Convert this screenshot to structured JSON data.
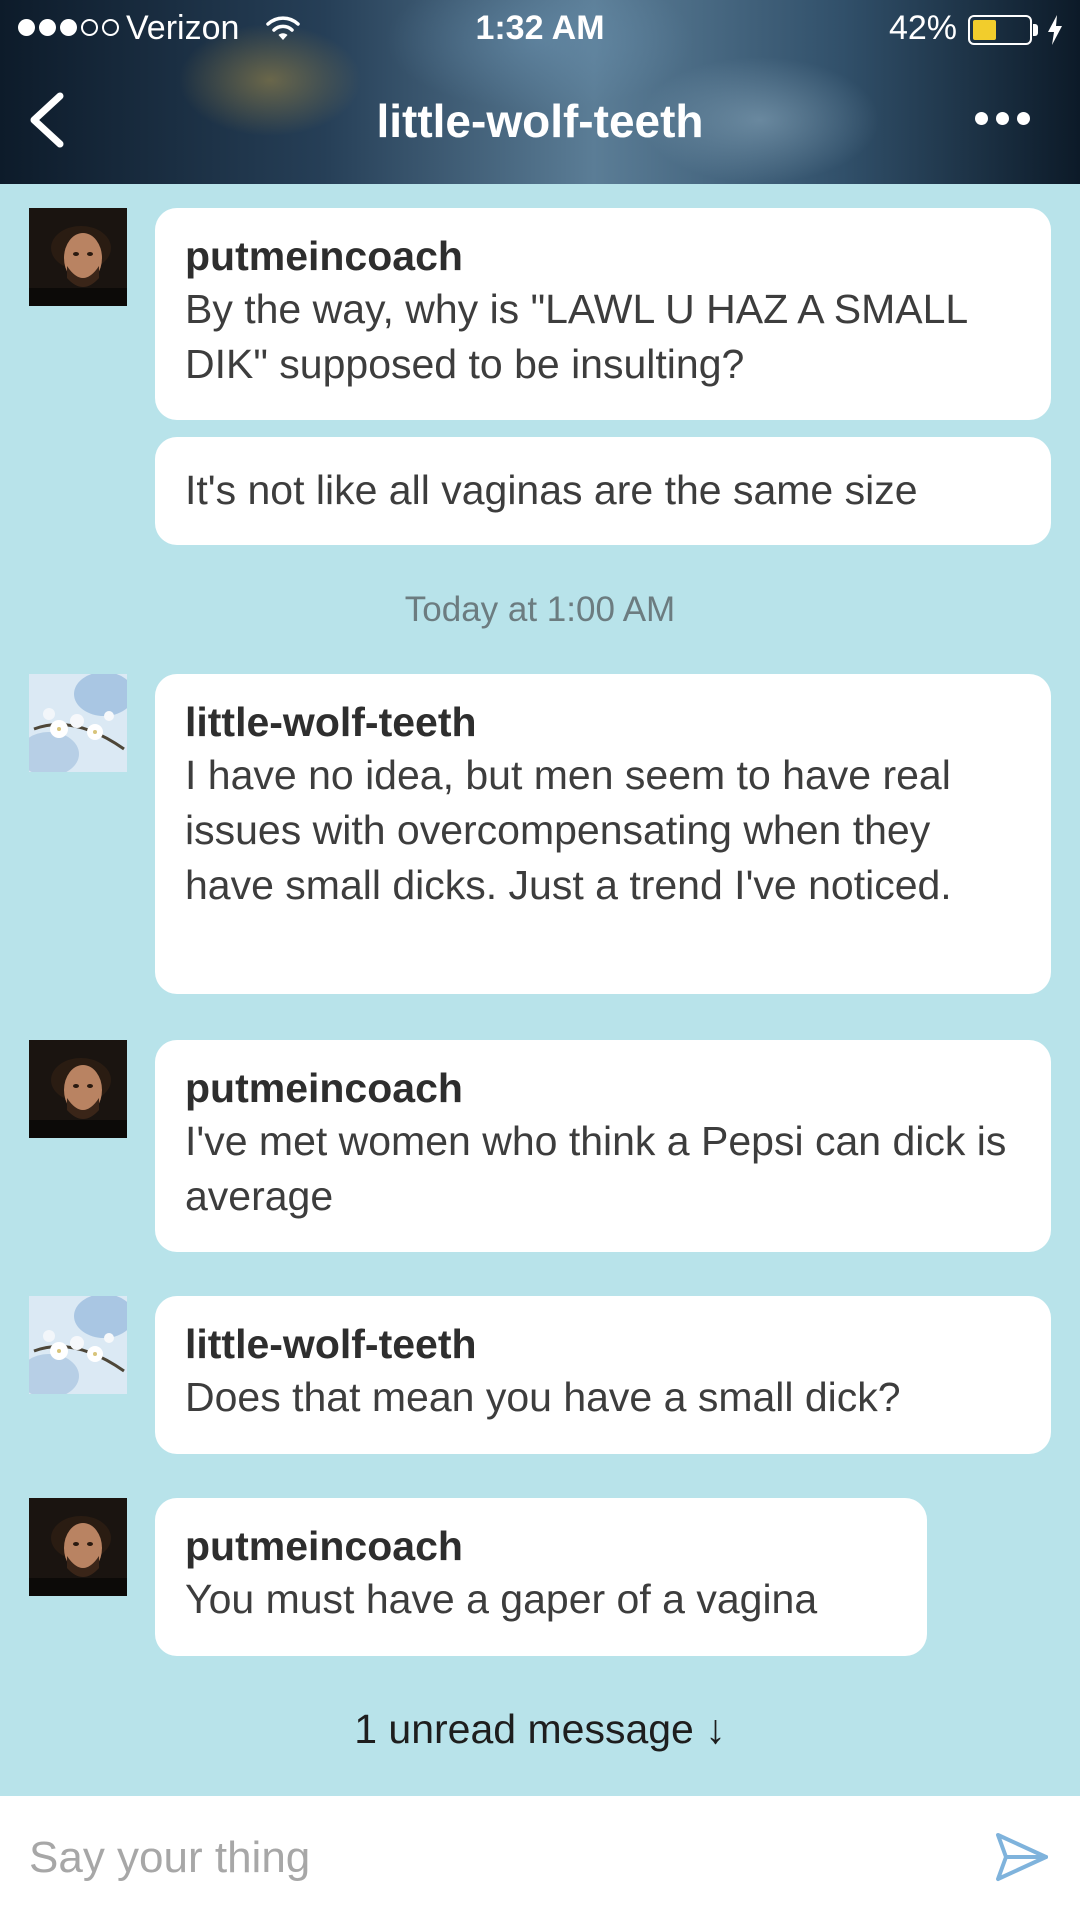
{
  "status_bar": {
    "signal_bars_filled": 3,
    "signal_bars_total": 5,
    "carrier": "Verizon",
    "time": "1:32 AM",
    "battery_percent_text": "42%",
    "battery_level": 0.42,
    "battery_color": "#f2cd2c",
    "icons": [
      "wifi-icon",
      "battery-icon",
      "charging-bolt-icon"
    ]
  },
  "nav": {
    "back_icon": "chevron-left-icon",
    "title": "little-wolf-teeth",
    "more_icon": "more-dots-icon"
  },
  "messages": [
    {
      "sender": "putmeincoach",
      "avatar": "putmeincoach-avatar",
      "text": "By the way, why is \"LAWL U HAZ A SMALL DIK\" supposed to be insulting?"
    },
    {
      "continuation_text": "It's not like all vaginas are the same size"
    },
    {
      "timestamp": "Today at 1:00 AM"
    },
    {
      "sender": "little-wolf-teeth",
      "avatar": "little-wolf-teeth-avatar",
      "text": "I have no idea, but men seem to have real issues with overcompensating when they have small dicks. Just a trend I've noticed."
    },
    {
      "sender": "putmeincoach",
      "avatar": "putmeincoach-avatar",
      "text": "I've met women who think a Pepsi can dick is average"
    },
    {
      "sender": "little-wolf-teeth",
      "avatar": "little-wolf-teeth-avatar",
      "text": "Does that mean you have a small dick?"
    },
    {
      "sender": "putmeincoach",
      "avatar": "putmeincoach-avatar",
      "text": "You must have a gaper of a vagina"
    }
  ],
  "unread_indicator": {
    "label": "1 unread message",
    "arrow": "↓"
  },
  "composer": {
    "placeholder": "Say your thing",
    "value": "",
    "send_icon": "send-icon"
  },
  "colors": {
    "background": "#b8e3ea",
    "bubble": "#ffffff",
    "send_icon": "#7fb3dc"
  }
}
